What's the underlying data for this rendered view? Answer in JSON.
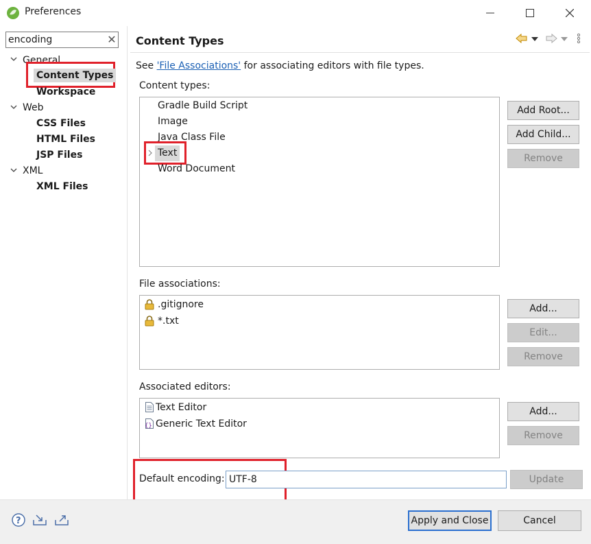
{
  "window": {
    "title": "Preferences"
  },
  "filter": {
    "value": "encoding"
  },
  "tree": {
    "general": "General",
    "content_types": "Content Types",
    "workspace": "Workspace",
    "web": "Web",
    "css_files": "CSS Files",
    "html_files": "HTML Files",
    "jsp_files": "JSP Files",
    "xml": "XML",
    "xml_files": "XML Files"
  },
  "page": {
    "title": "Content Types",
    "see_prefix": "See ",
    "see_link": "'File Associations'",
    "see_suffix": " for associating editors with file types.",
    "content_types_label": "Content types:",
    "content_types": [
      "Gradle Build Script",
      "Image",
      "Java Class File",
      "Text",
      "Word Document"
    ],
    "file_assoc_label": "File associations:",
    "file_assoc": [
      ".gitignore",
      "*.txt"
    ],
    "assoc_editors_label": "Associated editors:",
    "assoc_editors": [
      "Text Editor",
      "Generic Text Editor"
    ],
    "default_encoding_label": "Default encoding:",
    "default_encoding_value": "UTF-8"
  },
  "buttons": {
    "add_root": "Add Root...",
    "add_child": "Add Child...",
    "remove_ct": "Remove",
    "add_fa": "Add...",
    "edit_fa": "Edit...",
    "remove_fa": "Remove",
    "add_ed": "Add...",
    "remove_ed": "Remove",
    "update": "Update",
    "apply_close": "Apply and Close",
    "cancel": "Cancel"
  },
  "colors": {
    "highlight": "#e0202a",
    "link": "#1a5fb4",
    "lock": "#d4a017"
  }
}
